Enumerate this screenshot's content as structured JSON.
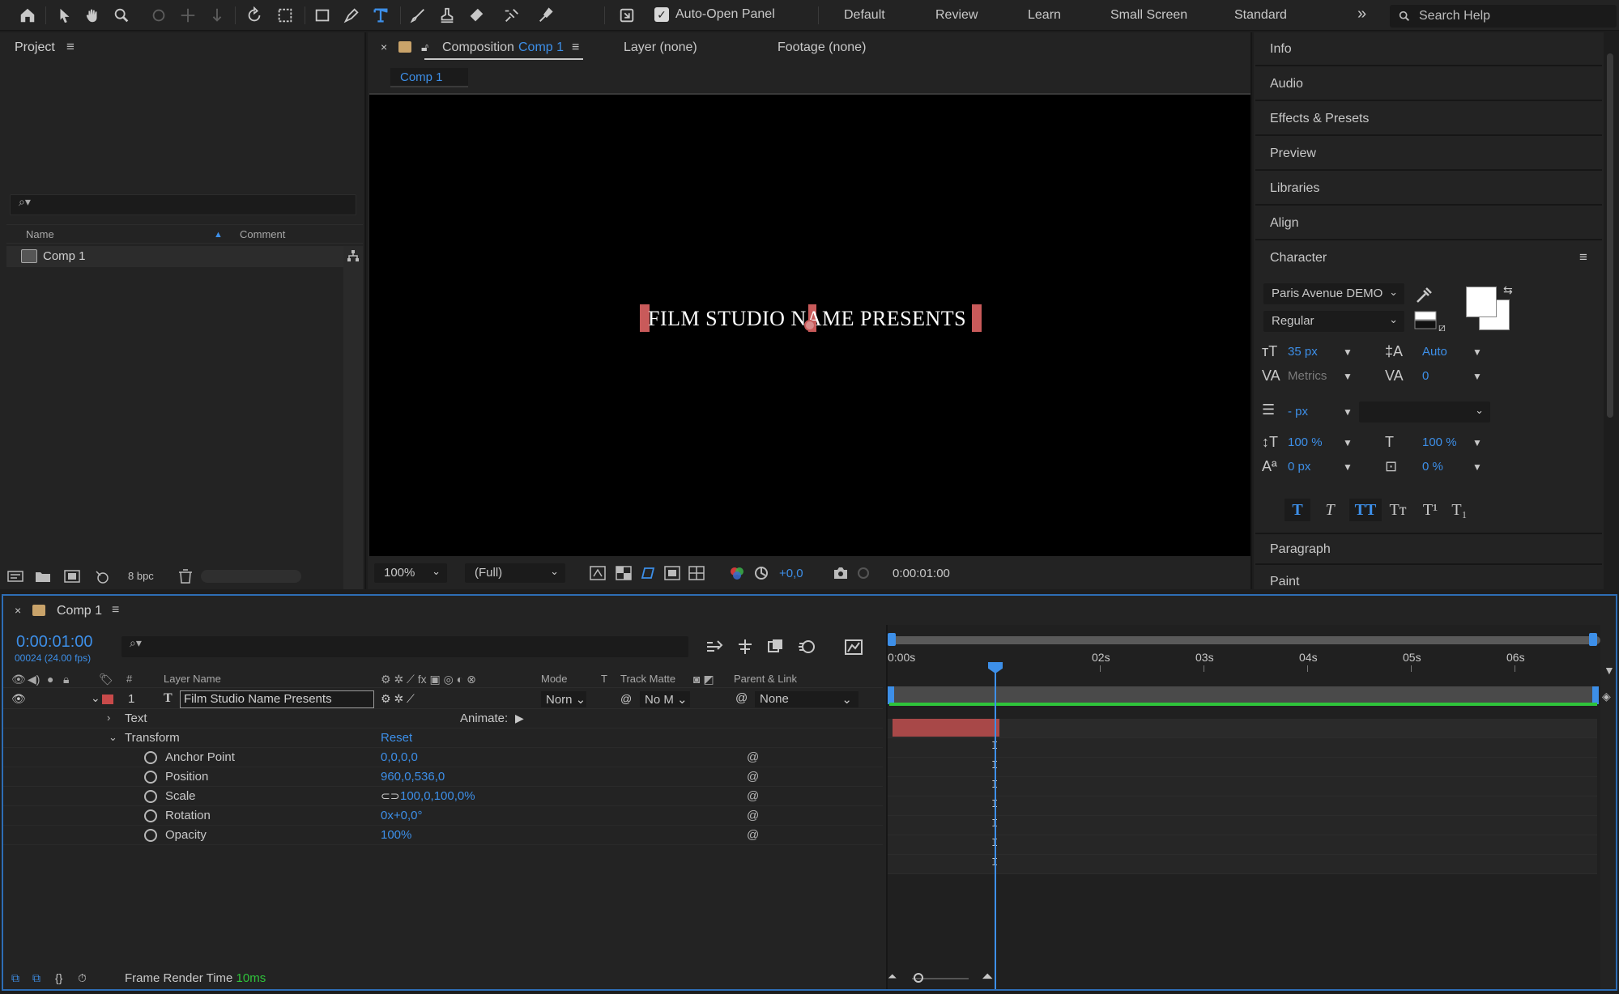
{
  "toolbar": {
    "auto_open_panel_label": "Auto-Open Panel",
    "workspaces": [
      "Default",
      "Review",
      "Learn",
      "Small Screen",
      "Standard"
    ],
    "more_workspaces": "»",
    "search_placeholder": "Search Help"
  },
  "project": {
    "title": "Project",
    "search_icon": "⌕▾",
    "columns": {
      "name": "Name",
      "comment": "Comment"
    },
    "items": [
      {
        "name": "Comp 1",
        "type": "composition"
      }
    ],
    "bit_depth": "8 bpc"
  },
  "composition": {
    "tab_prefix": "Composition",
    "tab_comp": "Comp 1",
    "layer_tab": "Layer (none)",
    "footage_tab": "Footage (none)",
    "breadcrumb": "Comp 1",
    "canvas_text": "FILM STUDIO NAME PRESENTS",
    "zoom": "100%",
    "resolution": "(Full)",
    "exposure": "+0,0",
    "timecode": "0:00:01:00"
  },
  "right_panels": {
    "sections": [
      "Info",
      "Audio",
      "Effects & Presets",
      "Preview",
      "Libraries",
      "Align"
    ],
    "character_title": "Character",
    "paragraph": "Paragraph",
    "paint": "Paint",
    "font_family": "Paris Avenue DEMO",
    "font_style": "Regular",
    "font_size": "35 px",
    "leading": "Auto",
    "kerning": "Metrics",
    "tracking": "0",
    "stroke_width": "- px",
    "vertical_scale": "100 %",
    "horizontal_scale": "100 %",
    "baseline_shift": "0 px",
    "tsume": "0 %",
    "style_buttons": [
      "T",
      "T",
      "TT",
      "Tт",
      "T¹",
      "T₁"
    ]
  },
  "timeline": {
    "comp_tab": "Comp 1",
    "current_time": "0:00:01:00",
    "frame_info": "00024 (24.00 fps)",
    "columns": {
      "layer_name": "Layer Name",
      "number": "#",
      "mode": "Mode",
      "t": "T",
      "track_matte": "Track Matte",
      "parent_link": "Parent & Link"
    },
    "layer": {
      "index": "1",
      "type_icon": "T",
      "name": "Film Studio Name Presents",
      "mode": "Norn",
      "track_matte": "No M",
      "parent": "None"
    },
    "text_group": "Text",
    "animate_label": "Animate:",
    "transform_group": "Transform",
    "reset_label": "Reset",
    "properties": [
      {
        "name": "Anchor Point",
        "value": "0,0,0,0"
      },
      {
        "name": "Position",
        "value": "960,0,536,0"
      },
      {
        "name": "Scale",
        "value": "100,0,100,0%"
      },
      {
        "name": "Rotation",
        "value": "0x+0,0°"
      },
      {
        "name": "Opacity",
        "value": "100%"
      }
    ],
    "ruler": [
      "0:00s",
      "02s",
      "03s",
      "04s",
      "05s",
      "06s"
    ],
    "frame_render_label": "Frame Render Time",
    "frame_render_value": "10ms"
  },
  "colors": {
    "accent": "#3d8fe8",
    "label_red": "#c84a4a",
    "work_area_green": "#2fc43b",
    "panel_bg": "#232323"
  }
}
